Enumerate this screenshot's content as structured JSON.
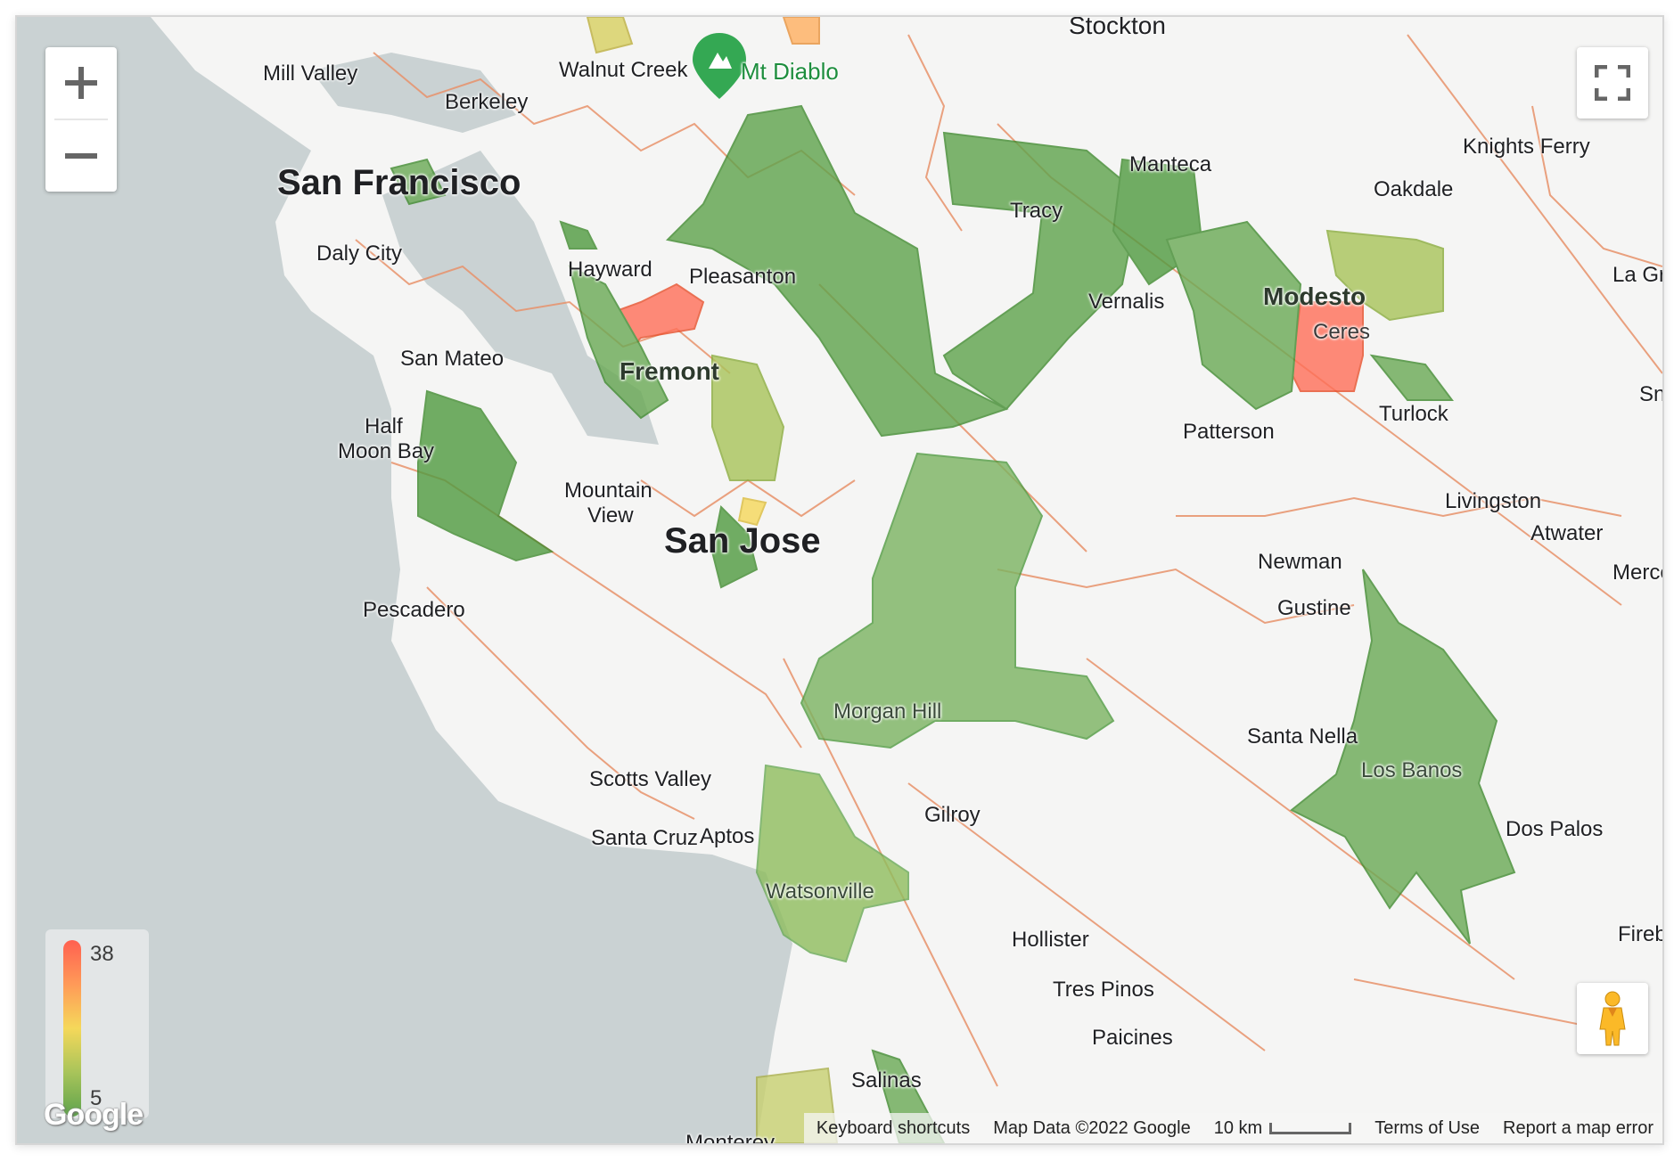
{
  "map": {
    "type": "choropleth",
    "legend": {
      "max": "38",
      "min": "5",
      "colors": [
        "#ff6050",
        "#f5d85a",
        "#5ea34c"
      ]
    },
    "labels": {
      "mill_valley": "Mill Valley",
      "berkeley": "Berkeley",
      "walnut_creek": "Walnut Creek",
      "mt_diablo": "Mt Diablo",
      "stockton": "Stockton",
      "san_francisco": "San Francisco",
      "daly_city": "Daly City",
      "hayward": "Hayward",
      "pleasanton": "Pleasanton",
      "manteca": "Manteca",
      "tracy": "Tracy",
      "knights_ferry": "Knights Ferry",
      "oakdale": "Oakdale",
      "la_grange": "La Gra",
      "vernalis": "Vernalis",
      "modesto": "Modesto",
      "ceres": "Ceres",
      "san_mateo": "San Mateo",
      "fremont": "Fremont",
      "half_moon_bay_1": "Half",
      "half_moon_bay_2": "Moon Bay",
      "turlock": "Turlock",
      "snelling": "Sne",
      "patterson": "Patterson",
      "mountain_view_1": "Mountain",
      "mountain_view_2": "View",
      "livingston": "Livingston",
      "atwater": "Atwater",
      "san_jose": "San Jose",
      "newman": "Newman",
      "merced": "Merce",
      "pescadero": "Pescadero",
      "gustine": "Gustine",
      "morgan_hill": "Morgan Hill",
      "santa_nella": "Santa Nella",
      "los_banos": "Los Banos",
      "scotts_valley": "Scotts Valley",
      "gilroy": "Gilroy",
      "santa_cruz": "Santa Cruz",
      "aptos": "Aptos",
      "dos_palos": "Dos Palos",
      "watsonville": "Watsonville",
      "hollister": "Hollister",
      "firebaugh": "Fireba",
      "tres_pinos": "Tres Pinos",
      "paicines": "Paicines",
      "salinas": "Salinas",
      "monterey": "Monterey"
    }
  },
  "controls": {
    "zoom_in": "+",
    "zoom_out": "−",
    "fullscreen": "fullscreen-icon",
    "pegman": "street-view-pegman"
  },
  "footer": {
    "logo": "Google",
    "keyboard_shortcuts": "Keyboard shortcuts",
    "map_data": "Map Data ©2022 Google",
    "scale": "10 km",
    "terms": "Terms of Use",
    "report": "Report a map error"
  }
}
